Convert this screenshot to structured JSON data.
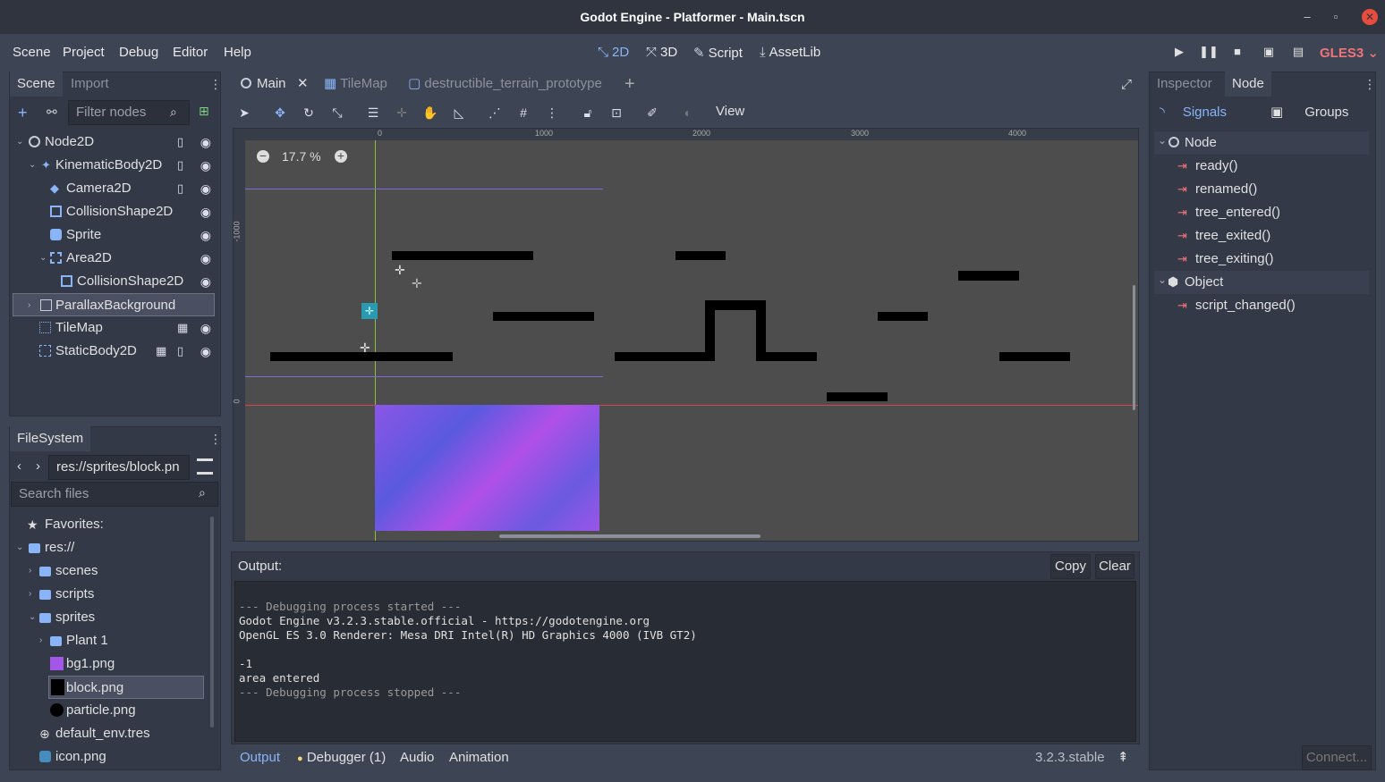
{
  "window": {
    "title": "Godot Engine - Platformer - Main.tscn"
  },
  "menu": [
    "Scene",
    "Project",
    "Debug",
    "Editor",
    "Help"
  ],
  "modes": [
    {
      "label": "2D",
      "active": true
    },
    {
      "label": "3D"
    },
    {
      "label": "Script"
    },
    {
      "label": "AssetLib"
    }
  ],
  "renderer": "GLES3",
  "scene_dock": {
    "tabs": [
      "Scene",
      "Import"
    ],
    "filter_placeholder": "Filter nodes",
    "nodes": [
      {
        "name": "Node2D"
      },
      {
        "name": "KinematicBody2D"
      },
      {
        "name": "Camera2D"
      },
      {
        "name": "CollisionShape2D"
      },
      {
        "name": "Sprite"
      },
      {
        "name": "Area2D"
      },
      {
        "name": "CollisionShape2D"
      },
      {
        "name": "ParallaxBackground",
        "selected": true
      },
      {
        "name": "TileMap"
      },
      {
        "name": "StaticBody2D"
      }
    ]
  },
  "filesystem": {
    "title": "FileSystem",
    "path": "res://sprites/block.pn",
    "search_placeholder": "Search files",
    "items": [
      {
        "name": "Favorites:"
      },
      {
        "name": "res://"
      },
      {
        "name": "scenes"
      },
      {
        "name": "scripts"
      },
      {
        "name": "sprites"
      },
      {
        "name": "Plant 1"
      },
      {
        "name": "bg1.png"
      },
      {
        "name": "block.png",
        "selected": true
      },
      {
        "name": "particle.png"
      },
      {
        "name": "default_env.tres"
      },
      {
        "name": "icon.png"
      }
    ]
  },
  "editor_tabs": [
    "Main",
    "TileMap",
    "destructible_terrain_prototype"
  ],
  "viewport": {
    "zoom": "17.7 %",
    "view_menu": "View",
    "ruler_h": [
      "0",
      "1000",
      "2000",
      "3000",
      "4000"
    ],
    "ruler_v": [
      "-1000",
      "0"
    ]
  },
  "output": {
    "label": "Output:",
    "copy": "Copy",
    "clear": "Clear",
    "lines": [
      "--- Debugging process started ---",
      "Godot Engine v3.2.3.stable.official - https://godotengine.org",
      "OpenGL ES 3.0 Renderer: Mesa DRI Intel(R) HD Graphics 4000 (IVB GT2)",
      "",
      "-1",
      "area entered",
      "--- Debugging process stopped ---"
    ]
  },
  "bottom_tabs": [
    "Output",
    "Debugger (1)",
    "Audio",
    "Animation"
  ],
  "version": "3.2.3.stable",
  "inspector": {
    "tabs": [
      "Inspector",
      "Node"
    ],
    "subtabs": [
      "Signals",
      "Groups"
    ],
    "groups": [
      {
        "name": "Node",
        "signals": [
          "ready()",
          "renamed()",
          "tree_entered()",
          "tree_exited()",
          "tree_exiting()"
        ]
      },
      {
        "name": "Object",
        "signals": [
          "script_changed()"
        ]
      }
    ],
    "connect_button": "Connect..."
  }
}
